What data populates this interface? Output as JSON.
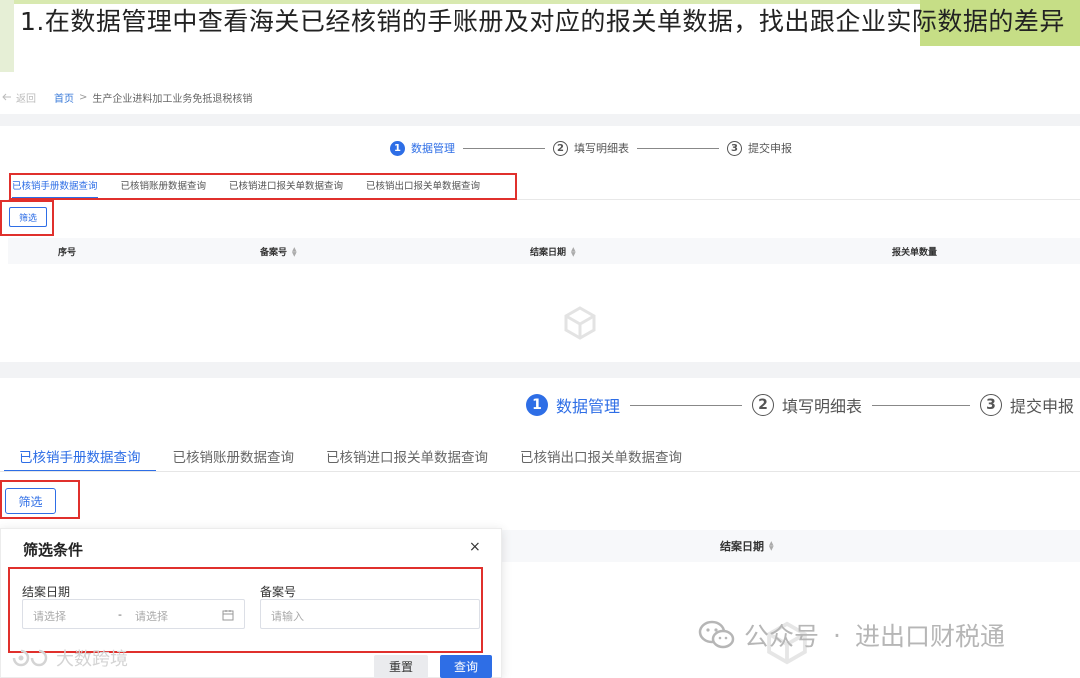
{
  "slide": {
    "title": "1.在数据管理中查看海关已经核销的手账册及对应的报关单数据，找出跟企业实际数据的差异"
  },
  "breadcrumb": {
    "back": "返回",
    "home": "首页",
    "separator": ">",
    "current": "生产企业进料加工业务免抵退税核销"
  },
  "steps": [
    {
      "num": "1",
      "label": "数据管理"
    },
    {
      "num": "2",
      "label": "填写明细表"
    },
    {
      "num": "3",
      "label": "提交申报"
    }
  ],
  "tabs": [
    "已核销手册数据查询",
    "已核销账册数据查询",
    "已核销进口报关单数据查询",
    "已核销出口报关单数据查询"
  ],
  "filter_button": "筛选",
  "table": {
    "columns": [
      "序号",
      "备案号",
      "结案日期",
      "报关单数量"
    ]
  },
  "popup": {
    "title": "筛选条件",
    "close": "×",
    "date_label": "结案日期",
    "date_start_placeholder": "请选择",
    "date_separator": "-",
    "date_end_placeholder": "请选择",
    "record_label": "备案号",
    "record_placeholder": "请输入",
    "reset": "重置",
    "query": "查询"
  },
  "lower_table": {
    "column": "结案日期"
  },
  "watermark": {
    "account": "公众号",
    "dot": "·",
    "name": "进出口财税通",
    "source": "大数跨境"
  },
  "colors": {
    "accent": "#2e6ee6",
    "annotation": "#e0302c",
    "title_bar": "#c6de86"
  }
}
